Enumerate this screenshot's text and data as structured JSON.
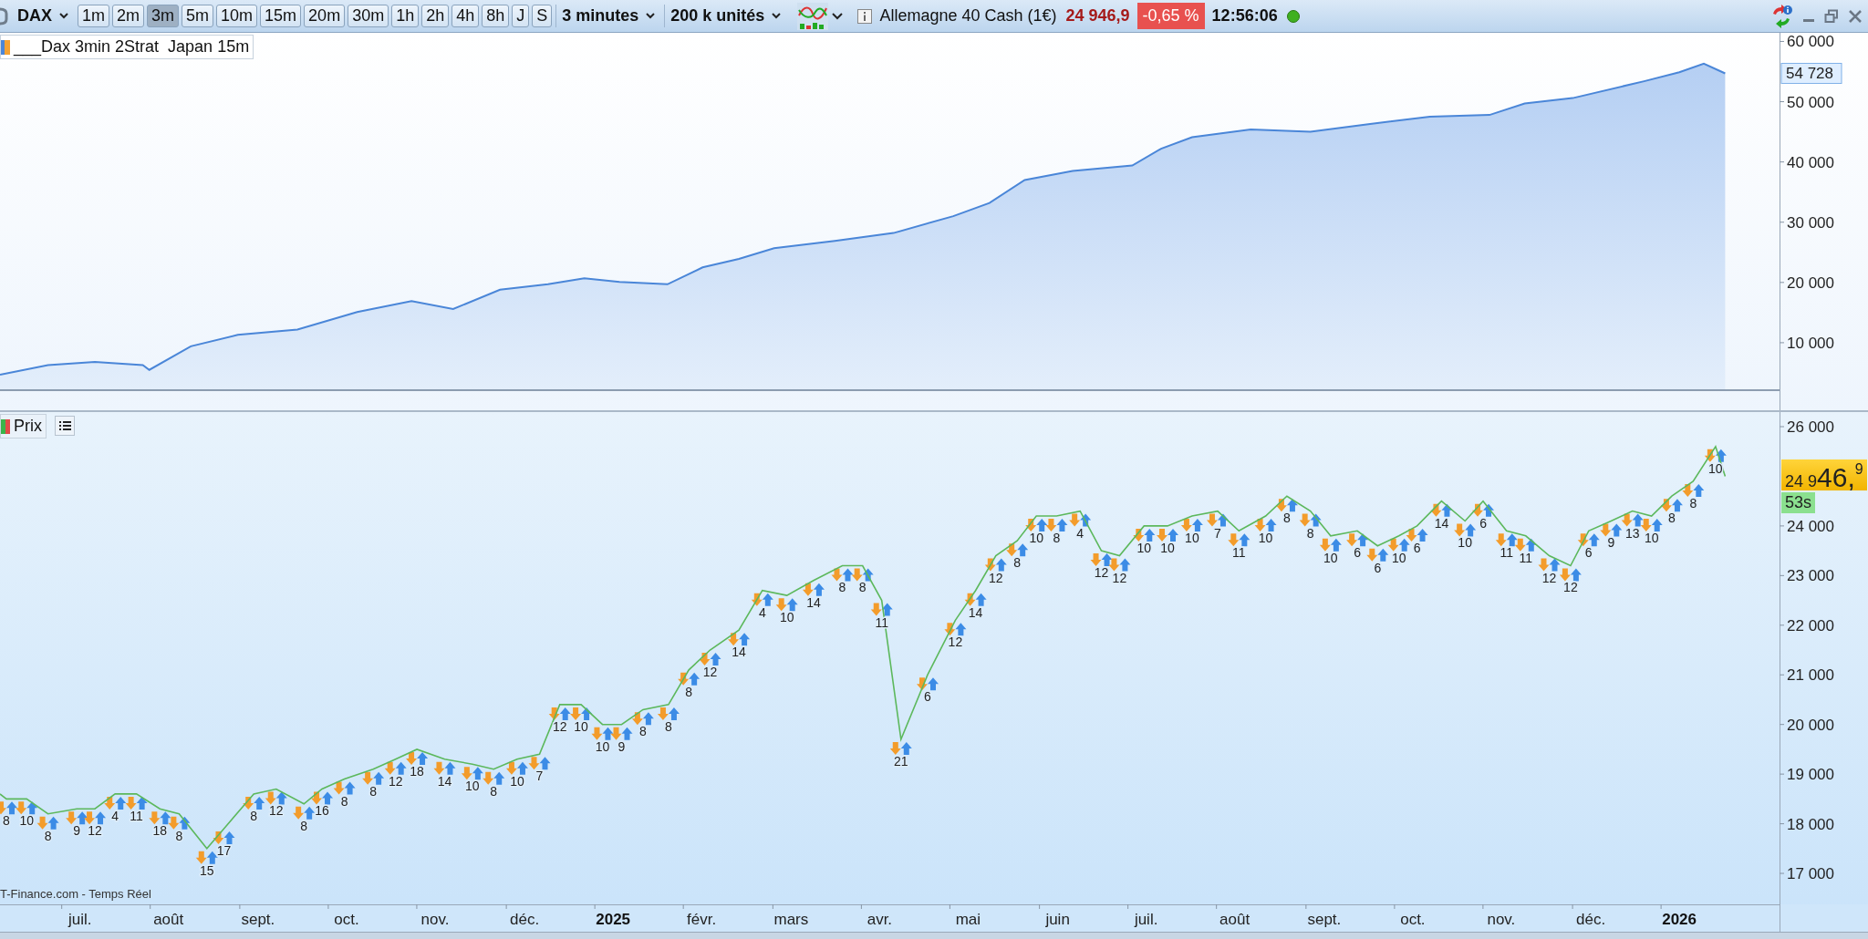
{
  "toolbar": {
    "instrument": "DAX",
    "timeframes": [
      {
        "label": "1m",
        "selected": false
      },
      {
        "label": "2m",
        "selected": false
      },
      {
        "label": "3m",
        "selected": true
      },
      {
        "label": "5m",
        "selected": false
      },
      {
        "label": "10m",
        "selected": false
      },
      {
        "label": "15m",
        "selected": false
      },
      {
        "label": "20m",
        "selected": false
      },
      {
        "label": "30m",
        "selected": false
      },
      {
        "label": "1h",
        "selected": false
      },
      {
        "label": "2h",
        "selected": false
      },
      {
        "label": "4h",
        "selected": false
      },
      {
        "label": "8h",
        "selected": false
      },
      {
        "label": "J",
        "selected": false
      },
      {
        "label": "S",
        "selected": false
      }
    ],
    "period": "3 minutes",
    "units": "200 k unités",
    "market": {
      "name": "Allemagne 40 Cash (1€)",
      "price": "24 946,9",
      "change": "-0,65 %",
      "time": "12:56:06"
    }
  },
  "equity_panel": {
    "last_value": "54 728",
    "chart_data": {
      "type": "area",
      "xlim": [
        2024.425,
        2026.094
      ],
      "ylim": [
        2120,
        61430
      ],
      "x": [
        2024.425,
        2024.47,
        2024.514,
        2024.559,
        2024.565,
        2024.604,
        2024.648,
        2024.704,
        2024.76,
        2024.811,
        2024.85,
        2024.894,
        2024.939,
        2024.973,
        2025.006,
        2025.051,
        2025.084,
        2025.118,
        2025.151,
        2025.208,
        2025.263,
        2025.319,
        2025.353,
        2025.386,
        2025.431,
        2025.487,
        2025.514,
        2025.543,
        2025.598,
        2025.654,
        2025.71,
        2025.766,
        2025.822,
        2025.855,
        2025.9,
        2025.967,
        2026.0,
        2026.023,
        2026.043
      ],
      "series": [
        {
          "name": "___Dax 3min 2Strat  Japan 15m",
          "color": "#4a86d8",
          "values": [
            4700,
            6300,
            6800,
            6300,
            5500,
            9400,
            11300,
            12200,
            15100,
            16900,
            15600,
            18800,
            19700,
            20700,
            20100,
            19700,
            22500,
            23900,
            25700,
            26900,
            28200,
            31000,
            33200,
            37000,
            38500,
            39400,
            42200,
            44100,
            45400,
            45000,
            46300,
            47500,
            47800,
            49700,
            50600,
            53400,
            54900,
            56300,
            54700
          ]
        }
      ],
      "yticks": [
        {
          "value": 60000,
          "label": "60 000"
        },
        {
          "value": 50000,
          "label": "50 000"
        },
        {
          "value": 40000,
          "label": "40 000"
        },
        {
          "value": 30000,
          "label": "30 000"
        },
        {
          "value": 20000,
          "label": "20 000"
        },
        {
          "value": 10000,
          "label": "10 000"
        }
      ]
    }
  },
  "price_panel": {
    "countdown": "53s",
    "source": "T-Finance.com - Temps Réel",
    "price_tag": {
      "lead": "24 9",
      "main": "46,",
      "sup": "9"
    },
    "chart_data": {
      "type": "line",
      "xlim": [
        2024.425,
        2026.094
      ],
      "ylim": [
        16376,
        26294
      ],
      "x": [
        2024.425,
        2024.431,
        2024.45,
        2024.47,
        2024.497,
        2024.514,
        2024.533,
        2024.553,
        2024.575,
        2024.593,
        2024.619,
        2024.635,
        2024.663,
        2024.684,
        2024.71,
        2024.727,
        2024.748,
        2024.775,
        2024.796,
        2024.816,
        2024.842,
        2024.868,
        2024.888,
        2024.91,
        2024.931,
        2024.95,
        2024.97,
        2024.99,
        2025.008,
        2025.028,
        2025.052,
        2025.071,
        2025.091,
        2025.118,
        2025.14,
        2025.163,
        2025.188,
        2025.215,
        2025.234,
        2025.252,
        2025.27,
        2025.295,
        2025.321,
        2025.34,
        2025.359,
        2025.379,
        2025.397,
        2025.416,
        2025.438,
        2025.458,
        2025.475,
        2025.498,
        2025.52,
        2025.543,
        2025.567,
        2025.587,
        2025.612,
        2025.632,
        2025.654,
        2025.673,
        2025.698,
        2025.717,
        2025.737,
        2025.754,
        2025.777,
        2025.799,
        2025.816,
        2025.838,
        2025.856,
        2025.878,
        2025.898,
        2025.915,
        2025.936,
        2025.956,
        2025.974,
        2025.993,
        2026.013,
        2026.034,
        2026.043
      ],
      "series": [
        {
          "name": "Prix",
          "color": "#5cb85c",
          "values": [
            18600,
            18500,
            18500,
            18200,
            18300,
            18300,
            18600,
            18600,
            18300,
            18200,
            17500,
            17900,
            18600,
            18700,
            18400,
            18700,
            18900,
            19100,
            19300,
            19500,
            19300,
            19200,
            19100,
            19300,
            19400,
            20400,
            20400,
            20000,
            20000,
            20300,
            20400,
            21100,
            21500,
            21900,
            22700,
            22600,
            22900,
            23200,
            23200,
            22500,
            19700,
            21000,
            22100,
            22700,
            23400,
            23700,
            24200,
            24200,
            24300,
            23500,
            23400,
            24000,
            24000,
            24200,
            24300,
            23900,
            24200,
            24600,
            24300,
            23800,
            23900,
            23600,
            23800,
            24000,
            24500,
            24100,
            24500,
            23900,
            23800,
            23400,
            23200,
            23900,
            24100,
            24300,
            24200,
            24600,
            24900,
            25600,
            25000
          ]
        }
      ],
      "yticks": [
        {
          "value": 26000,
          "label": "26 000"
        },
        {
          "value": 24000,
          "label": "24 000"
        },
        {
          "value": 23000,
          "label": "23 000"
        },
        {
          "value": 22000,
          "label": "22 000"
        },
        {
          "value": 21000,
          "label": "21 000"
        },
        {
          "value": 20000,
          "label": "20 000"
        },
        {
          "value": 19000,
          "label": "19 000"
        },
        {
          "value": 18000,
          "label": "18 000"
        },
        {
          "value": 17000,
          "label": "17 000"
        }
      ],
      "xticks": [
        {
          "value": 2024.5,
          "label": "juil."
        },
        {
          "value": 2024.583,
          "label": "août"
        },
        {
          "value": 2024.667,
          "label": "sept."
        },
        {
          "value": 2024.75,
          "label": "oct."
        },
        {
          "value": 2024.833,
          "label": "nov."
        },
        {
          "value": 2024.917,
          "label": "déc."
        },
        {
          "value": 2025,
          "label": "2025"
        },
        {
          "value": 2025.083,
          "label": "févr."
        },
        {
          "value": 2025.167,
          "label": "mars"
        },
        {
          "value": 2025.25,
          "label": "avr."
        },
        {
          "value": 2025.333,
          "label": "mai"
        },
        {
          "value": 2025.417,
          "label": "juin"
        },
        {
          "value": 2025.5,
          "label": "juil."
        },
        {
          "value": 2025.583,
          "label": "août"
        },
        {
          "value": 2025.667,
          "label": "sept."
        },
        {
          "value": 2025.75,
          "label": "oct."
        },
        {
          "value": 2025.833,
          "label": "nov."
        },
        {
          "value": 2025.917,
          "label": "déc."
        },
        {
          "value": 2026,
          "label": "2026"
        }
      ],
      "annotations": [
        {
          "x": 2024.431,
          "y": 18500,
          "text": "8"
        },
        {
          "x": 2024.45,
          "y": 18500,
          "text": "10"
        },
        {
          "x": 2024.47,
          "y": 18200,
          "text": "8"
        },
        {
          "x": 2024.497,
          "y": 18300,
          "text": "9"
        },
        {
          "x": 2024.514,
          "y": 18300,
          "text": "12"
        },
        {
          "x": 2024.533,
          "y": 18600,
          "text": "4"
        },
        {
          "x": 2024.553,
          "y": 18600,
          "text": "11"
        },
        {
          "x": 2024.575,
          "y": 18300,
          "text": "18"
        },
        {
          "x": 2024.593,
          "y": 18200,
          "text": "8"
        },
        {
          "x": 2024.619,
          "y": 17500,
          "text": "15"
        },
        {
          "x": 2024.635,
          "y": 17900,
          "text": "17"
        },
        {
          "x": 2024.663,
          "y": 18600,
          "text": "8"
        },
        {
          "x": 2024.684,
          "y": 18700,
          "text": "12"
        },
        {
          "x": 2024.71,
          "y": 18400,
          "text": "8"
        },
        {
          "x": 2024.727,
          "y": 18700,
          "text": "16"
        },
        {
          "x": 2024.748,
          "y": 18900,
          "text": "8"
        },
        {
          "x": 2024.775,
          "y": 19100,
          "text": "8"
        },
        {
          "x": 2024.796,
          "y": 19300,
          "text": "12"
        },
        {
          "x": 2024.816,
          "y": 19500,
          "text": "18"
        },
        {
          "x": 2024.842,
          "y": 19300,
          "text": "14"
        },
        {
          "x": 2024.868,
          "y": 19200,
          "text": "10"
        },
        {
          "x": 2024.888,
          "y": 19100,
          "text": "8"
        },
        {
          "x": 2024.91,
          "y": 19300,
          "text": "10"
        },
        {
          "x": 2024.931,
          "y": 19400,
          "text": "7"
        },
        {
          "x": 2024.95,
          "y": 20400,
          "text": "12"
        },
        {
          "x": 2024.97,
          "y": 20400,
          "text": "10"
        },
        {
          "x": 2024.99,
          "y": 20000,
          "text": "10"
        },
        {
          "x": 2025.008,
          "y": 20000,
          "text": "9"
        },
        {
          "x": 2025.028,
          "y": 20300,
          "text": "8"
        },
        {
          "x": 2025.052,
          "y": 20400,
          "text": "8"
        },
        {
          "x": 2025.071,
          "y": 21100,
          "text": "8"
        },
        {
          "x": 2025.091,
          "y": 21500,
          "text": "12"
        },
        {
          "x": 2025.118,
          "y": 21900,
          "text": "14"
        },
        {
          "x": 2025.14,
          "y": 22700,
          "text": "4"
        },
        {
          "x": 2025.163,
          "y": 22600,
          "text": "10"
        },
        {
          "x": 2025.188,
          "y": 22900,
          "text": "14"
        },
        {
          "x": 2025.215,
          "y": 23200,
          "text": "8"
        },
        {
          "x": 2025.234,
          "y": 23200,
          "text": "8"
        },
        {
          "x": 2025.252,
          "y": 22500,
          "text": "11"
        },
        {
          "x": 2025.27,
          "y": 19700,
          "text": "21"
        },
        {
          "x": 2025.295,
          "y": 21000,
          "text": "6"
        },
        {
          "x": 2025.321,
          "y": 22100,
          "text": "12"
        },
        {
          "x": 2025.34,
          "y": 22700,
          "text": "14"
        },
        {
          "x": 2025.359,
          "y": 23400,
          "text": "12"
        },
        {
          "x": 2025.379,
          "y": 23700,
          "text": "8"
        },
        {
          "x": 2025.397,
          "y": 24200,
          "text": "10"
        },
        {
          "x": 2025.416,
          "y": 24200,
          "text": "8"
        },
        {
          "x": 2025.438,
          "y": 24300,
          "text": "4"
        },
        {
          "x": 2025.458,
          "y": 23500,
          "text": "12"
        },
        {
          "x": 2025.475,
          "y": 23400,
          "text": "12"
        },
        {
          "x": 2025.498,
          "y": 24000,
          "text": "10"
        },
        {
          "x": 2025.52,
          "y": 24000,
          "text": "10"
        },
        {
          "x": 2025.543,
          "y": 24200,
          "text": "10"
        },
        {
          "x": 2025.567,
          "y": 24300,
          "text": "7"
        },
        {
          "x": 2025.587,
          "y": 23900,
          "text": "11"
        },
        {
          "x": 2025.612,
          "y": 24200,
          "text": "10"
        },
        {
          "x": 2025.632,
          "y": 24600,
          "text": "8"
        },
        {
          "x": 2025.654,
          "y": 24300,
          "text": "8"
        },
        {
          "x": 2025.673,
          "y": 23800,
          "text": "10"
        },
        {
          "x": 2025.698,
          "y": 23900,
          "text": "6"
        },
        {
          "x": 2025.717,
          "y": 23600,
          "text": "6"
        },
        {
          "x": 2025.737,
          "y": 23800,
          "text": "10"
        },
        {
          "x": 2025.754,
          "y": 24000,
          "text": "6"
        },
        {
          "x": 2025.777,
          "y": 24500,
          "text": "14"
        },
        {
          "x": 2025.799,
          "y": 24100,
          "text": "10"
        },
        {
          "x": 2025.816,
          "y": 24500,
          "text": "6"
        },
        {
          "x": 2025.838,
          "y": 23900,
          "text": "11"
        },
        {
          "x": 2025.856,
          "y": 23800,
          "text": "11"
        },
        {
          "x": 2025.878,
          "y": 23400,
          "text": "12"
        },
        {
          "x": 2025.898,
          "y": 23200,
          "text": "12"
        },
        {
          "x": 2025.915,
          "y": 23900,
          "text": "6"
        },
        {
          "x": 2025.936,
          "y": 24100,
          "text": "9"
        },
        {
          "x": 2025.956,
          "y": 24300,
          "text": "13"
        },
        {
          "x": 2025.974,
          "y": 24200,
          "text": "10"
        },
        {
          "x": 2025.993,
          "y": 24600,
          "text": "8"
        },
        {
          "x": 2026.013,
          "y": 24900,
          "text": "8"
        },
        {
          "x": 2026.034,
          "y": 25600,
          "text": "10"
        }
      ]
    }
  }
}
